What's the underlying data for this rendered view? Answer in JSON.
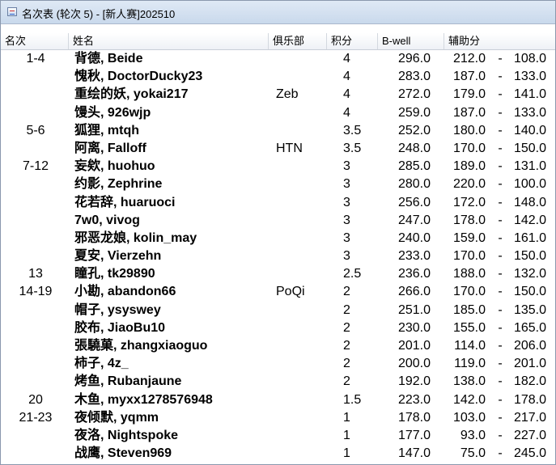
{
  "window": {
    "title": "名次表 (轮次 5) - [新人赛]202510",
    "icon": "table-window-icon"
  },
  "columns": [
    {
      "key": "rank",
      "label": "名次"
    },
    {
      "key": "name",
      "label": "姓名"
    },
    {
      "key": "club",
      "label": "俱乐部"
    },
    {
      "key": "points",
      "label": "积分"
    },
    {
      "key": "bwell",
      "label": "B-well"
    },
    {
      "key": "aux",
      "label": "辅助分"
    }
  ],
  "rows": [
    {
      "rank": "1-4",
      "name": "背德, Beide",
      "club": "",
      "points": "4",
      "bwell": "296.0",
      "aux1": "212.0",
      "aux2": "108.0"
    },
    {
      "rank": "",
      "name": "愧秋, DoctorDucky23",
      "club": "",
      "points": "4",
      "bwell": "283.0",
      "aux1": "187.0",
      "aux2": "133.0"
    },
    {
      "rank": "",
      "name": "重绘的妖, yokai217",
      "club": "Zeb",
      "points": "4",
      "bwell": "272.0",
      "aux1": "179.0",
      "aux2": "141.0"
    },
    {
      "rank": "",
      "name": "馒头, 926wjp",
      "club": "",
      "points": "4",
      "bwell": "259.0",
      "aux1": "187.0",
      "aux2": "133.0"
    },
    {
      "rank": "5-6",
      "name": "狐狸, mtqh",
      "club": "",
      "points": "3.5",
      "bwell": "252.0",
      "aux1": "180.0",
      "aux2": "140.0"
    },
    {
      "rank": "",
      "name": "阿离, Falloff",
      "club": "HTN",
      "points": "3.5",
      "bwell": "248.0",
      "aux1": "170.0",
      "aux2": "150.0"
    },
    {
      "rank": "7-12",
      "name": "妄欸, huohuo",
      "club": "",
      "points": "3",
      "bwell": "285.0",
      "aux1": "189.0",
      "aux2": "131.0"
    },
    {
      "rank": "",
      "name": "约影, Zephrine",
      "club": "",
      "points": "3",
      "bwell": "280.0",
      "aux1": "220.0",
      "aux2": "100.0"
    },
    {
      "rank": "",
      "name": "花若辞, huaruoci",
      "club": "",
      "points": "3",
      "bwell": "256.0",
      "aux1": "172.0",
      "aux2": "148.0"
    },
    {
      "rank": "",
      "name": "7w0, vivog",
      "club": "",
      "points": "3",
      "bwell": "247.0",
      "aux1": "178.0",
      "aux2": "142.0"
    },
    {
      "rank": "",
      "name": "邪恶龙娘, kolin_may",
      "club": "",
      "points": "3",
      "bwell": "240.0",
      "aux1": "159.0",
      "aux2": "161.0"
    },
    {
      "rank": "",
      "name": "夏安, Vierzehn",
      "club": "",
      "points": "3",
      "bwell": "233.0",
      "aux1": "170.0",
      "aux2": "150.0"
    },
    {
      "rank": "13",
      "name": "瞳孔, tk29890",
      "club": "",
      "points": "2.5",
      "bwell": "236.0",
      "aux1": "188.0",
      "aux2": "132.0"
    },
    {
      "rank": "14-19",
      "name": "小勘, abandon66",
      "club": "PoQi",
      "points": "2",
      "bwell": "266.0",
      "aux1": "170.0",
      "aux2": "150.0"
    },
    {
      "rank": "",
      "name": "帽子, ysyswey",
      "club": "",
      "points": "2",
      "bwell": "251.0",
      "aux1": "185.0",
      "aux2": "135.0"
    },
    {
      "rank": "",
      "name": "胶布, JiaoBu10",
      "club": "",
      "points": "2",
      "bwell": "230.0",
      "aux1": "155.0",
      "aux2": "165.0"
    },
    {
      "rank": "",
      "name": "張驍菓, zhangxiaoguo",
      "club": "",
      "points": "2",
      "bwell": "201.0",
      "aux1": "114.0",
      "aux2": "206.0"
    },
    {
      "rank": "",
      "name": "柿子, 4z_",
      "club": "",
      "points": "2",
      "bwell": "200.0",
      "aux1": "119.0",
      "aux2": "201.0"
    },
    {
      "rank": "",
      "name": "烤鱼, Rubanjaune",
      "club": "",
      "points": "2",
      "bwell": "192.0",
      "aux1": "138.0",
      "aux2": "182.0"
    },
    {
      "rank": "20",
      "name": "木鱼, myxx1278576948",
      "club": "",
      "points": "1.5",
      "bwell": "223.0",
      "aux1": "142.0",
      "aux2": "178.0"
    },
    {
      "rank": "21-23",
      "name": "夜倾默, yqmm",
      "club": "",
      "points": "1",
      "bwell": "178.0",
      "aux1": "103.0",
      "aux2": "217.0"
    },
    {
      "rank": "",
      "name": "夜洛, Nightspoke",
      "club": "",
      "points": "1",
      "bwell": "177.0",
      "aux1": "93.0",
      "aux2": "227.0"
    },
    {
      "rank": "",
      "name": "战鹰, Steven969",
      "club": "",
      "points": "1",
      "bwell": "147.0",
      "aux1": "75.0",
      "aux2": "245.0"
    }
  ],
  "aux_separator": "-"
}
